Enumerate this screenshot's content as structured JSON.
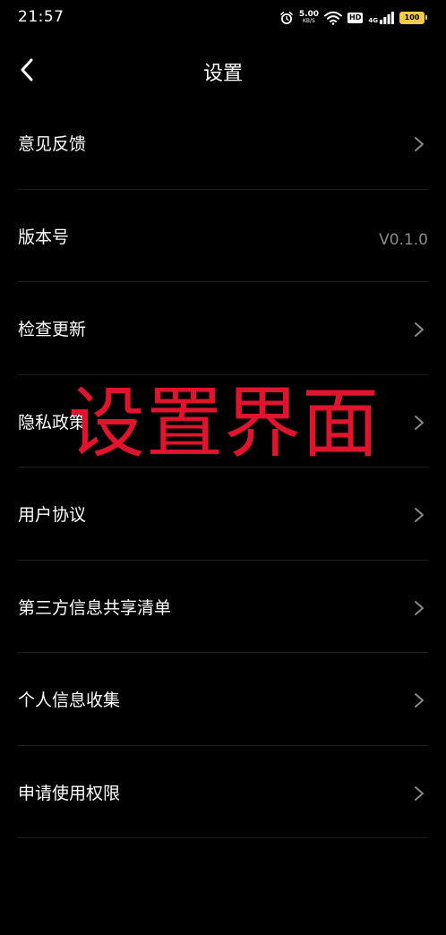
{
  "status_bar": {
    "time": "21:57",
    "net_speed_value": "5.00",
    "net_speed_unit": "KB/S",
    "hd_label": "HD",
    "signal_label": "4G",
    "battery_level": "100",
    "battery_color": "#f2c94c",
    "icons": [
      "alarm-icon",
      "wifi-icon",
      "signal-icon",
      "battery-icon"
    ]
  },
  "header": {
    "back_icon": "chevron-left-icon",
    "title": "设置"
  },
  "settings": {
    "items": [
      {
        "label": "意见反馈",
        "value": "",
        "icon": "chevron-right-icon"
      },
      {
        "label": "版本号",
        "value": "V0.1.0",
        "icon": ""
      },
      {
        "label": "检查更新",
        "value": "",
        "icon": "chevron-right-icon"
      },
      {
        "label": "隐私政策",
        "value": "",
        "icon": "chevron-right-icon"
      },
      {
        "label": "用户协议",
        "value": "",
        "icon": "chevron-right-icon"
      },
      {
        "label": "第三方信息共享清单",
        "value": "",
        "icon": "chevron-right-icon"
      },
      {
        "label": "个人信息收集",
        "value": "",
        "icon": "chevron-right-icon"
      },
      {
        "label": "申请使用权限",
        "value": "",
        "icon": "chevron-right-icon"
      }
    ]
  },
  "overlay": {
    "caption": "设置界面",
    "color": "#e0142c"
  }
}
